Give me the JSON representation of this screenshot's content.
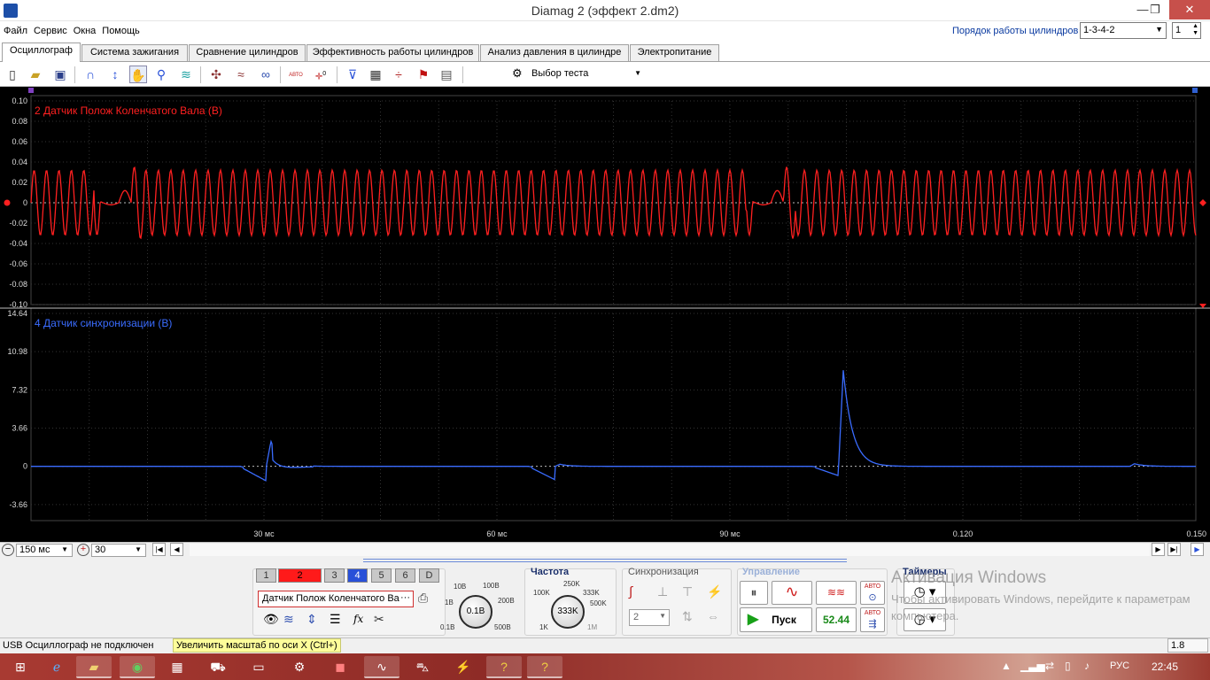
{
  "window": {
    "title": "Diamag 2 (эффект 2.dm2)",
    "min": "—",
    "restore": "❐",
    "close": "✕"
  },
  "menu": [
    "Файл",
    "Сервис",
    "Окна",
    "Помощь"
  ],
  "cylinders": {
    "label": "Порядок работы цилиндров",
    "order": "1-3-4-2",
    "number": "1"
  },
  "tabs": [
    "Осциллограф",
    "Система зажигания",
    "Сравнение цилиндров",
    "Эффективность работы цилиндров",
    "Анализ давления в цилиндре",
    "Электропитание"
  ],
  "toolbar": {
    "test_select": "Выбор теста",
    "auto_label": "АВТО",
    "zero_label": "0"
  },
  "chart_data": [
    {
      "type": "line",
      "title": "2 Датчик Полож Коленчатого Вала (В)",
      "color": "#ff2020",
      "yticks": [
        "0.10",
        "0.08",
        "0.06",
        "0.04",
        "0.02",
        "0",
        "-0.02",
        "-0.04",
        "-0.06",
        "-0.08",
        "-0.10"
      ],
      "ylim": [
        -0.1,
        0.1
      ],
      "xlim": [
        0,
        0.15
      ],
      "series": [
        {
          "description": "sinusoidal ~0.032 V amplitude, about 60 cycles per crankshaft revolution, two missing-tooth gaps",
          "gap_times_s": [
            0.0113,
            0.0953
          ],
          "amplitude_v": 0.032
        }
      ]
    },
    {
      "type": "line",
      "title": "4 Датчик синхронизации (В)",
      "color": "#3a6cff",
      "yticks": [
        "14.64",
        "10.98",
        "7.32",
        "3.66",
        "0",
        "-3.66"
      ],
      "ylim": [
        -5.2,
        14.64
      ],
      "xlim": [
        0,
        0.15
      ],
      "series": [
        {
          "baseline_v": 0,
          "spikes": [
            {
              "t": 0.0303,
              "peak": 2.4,
              "neg": -1.4
            },
            {
              "t": 0.0675,
              "peak": 0.2,
              "neg": -1.3
            },
            {
              "t": 0.104,
              "peak": 9.2,
              "neg": -0.9
            },
            {
              "t": 0.1415,
              "peak": 0.25,
              "neg": 0
            }
          ]
        }
      ]
    }
  ],
  "x_axis": {
    "ticks": [
      "30 мс",
      "60 мс",
      "90 мс",
      "0.120",
      "0.150"
    ],
    "tick_values": [
      0.03,
      0.06,
      0.09,
      0.12,
      0.15
    ]
  },
  "xcontrols": {
    "scale": "150 мс",
    "position": "30"
  },
  "channels": {
    "buttons": [
      "1",
      "2",
      "3",
      "4",
      "5",
      "6",
      "D"
    ],
    "active_name": "Датчик Полож Коленчатого Ва",
    "more": "···"
  },
  "voltage_knob": {
    "value": "0.1В",
    "labels": [
      "10В",
      "100В",
      "1В",
      "200В",
      "0.1В",
      "500В"
    ]
  },
  "frequency": {
    "title": "Частота",
    "value": "333K",
    "labels": [
      "250K",
      "100K",
      "333K",
      "500K",
      "1K",
      "1M"
    ]
  },
  "sync": {
    "title": "Синхронизация",
    "channel": "2"
  },
  "control": {
    "title": "Управление",
    "start": "Пуск",
    "value": "52.44",
    "auto1": "АВТО",
    "auto2": "АВТО"
  },
  "timers": {
    "title": "Таймеры"
  },
  "status": {
    "connection": "USB Осциллограф не подключен",
    "hint": "Увеличить масштаб по оси X (Ctrl+)",
    "right": "1.8"
  },
  "watermark": {
    "line1": "Активация Windows",
    "line2": "Чтобы активировать Windows, перейдите к параметрам компьютера."
  },
  "taskbar": {
    "lang": "РУС",
    "time": "22:45"
  }
}
